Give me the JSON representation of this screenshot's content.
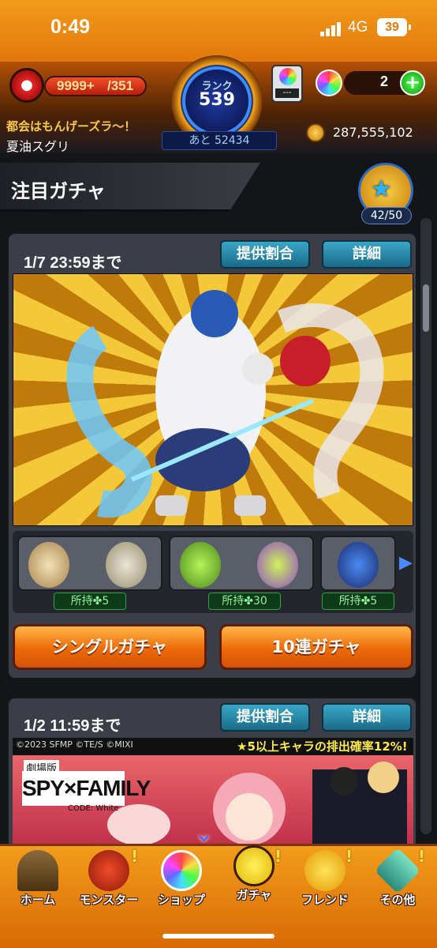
{
  "status_bar": {
    "time": "0:49",
    "network": "4G",
    "battery": "39"
  },
  "header": {
    "stamina_value": "9999+",
    "stamina_max": "/351",
    "rank_label": "ランク",
    "rank_number": "539",
    "rank_next": "あと 52434",
    "cart_label": "---",
    "orb_count": "2",
    "player_message": "都会はもんげーズラ〜！",
    "player_name": "夏油スグリ",
    "coins": "287,555,102"
  },
  "section": {
    "title": "注目ガチャ",
    "mission_count": "42/50"
  },
  "gacha1": {
    "deadline": "1/7 23:59まで",
    "rates_button": "提供割合",
    "details_button": "詳細",
    "owned": [
      "所持✤5",
      "所持✤30",
      "所持✤5"
    ],
    "single_button": "シングルガチャ",
    "ten_button": "10連ガチャ"
  },
  "gacha2": {
    "deadline": "1/2 11:59まで",
    "rates_button": "提供割合",
    "details_button": "詳細",
    "copyright": "©2023 SFMP ©TE/S ©MIXI",
    "promo": "★5以上キャラの排出確率12%!",
    "logo_top": "劇場版",
    "logo": "SPY×FAMILY",
    "logo_sub": "CODE: White"
  },
  "tabs": [
    "ホーム",
    "モンスター",
    "ショップ",
    "ガチャ",
    "フレンド",
    "その他"
  ],
  "colors": {
    "accent_orange": "#ec6a06",
    "teal_button": "#2a8aa8",
    "rank_blue": "#3a8cff"
  }
}
